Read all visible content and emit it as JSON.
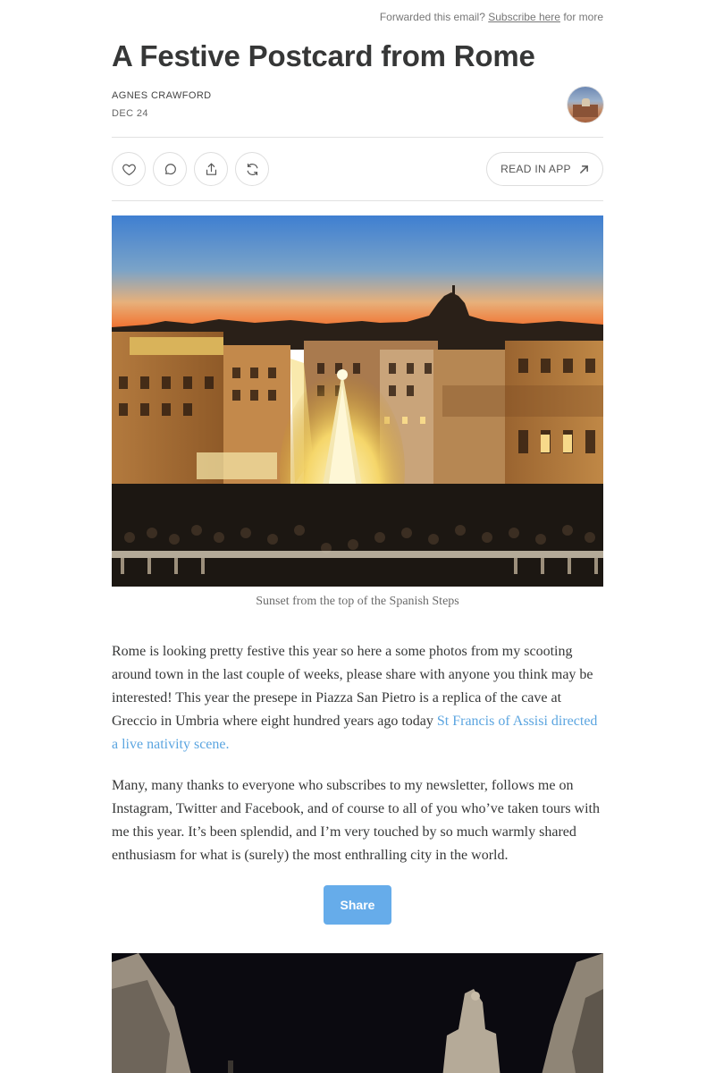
{
  "header": {
    "forward_text": "Forwarded this email?",
    "subscribe_link": "Subscribe here",
    "forward_suffix": "for more"
  },
  "post": {
    "title": "A Festive Postcard from Rome",
    "author": "AGNES CRAWFORD",
    "date": "DEC 24"
  },
  "actions": {
    "like_icon": "heart-icon",
    "comment_icon": "comment-icon",
    "share_icon": "share-icon",
    "restack_icon": "restack-icon",
    "read_in_app_label": "READ IN APP",
    "read_in_app_icon": "arrow-up-right-icon"
  },
  "images": [
    {
      "caption": "Sunset from the top of the Spanish Steps"
    },
    {
      "caption": ""
    }
  ],
  "body": {
    "p1_text": "Rome is looking pretty festive this year so here a some photos from my scooting around town in the last couple of weeks, please share with anyone you think may be interested! This year the presepe in Piazza San Pietro is a replica of the cave at Greccio in Umbria where eight hundred years ago today ",
    "p1_link": "St Francis of Assisi directed a live nativity scene.",
    "p2_text": "Many, many thanks to everyone who subscribes to my newsletter, follows me on Instagram, Twitter and Facebook, and of course to all of you who’ve taken tours with me this year. It’s been splendid, and I’m very touched by so much warmly shared enthusiasm for what is (surely) the most enthralling city in the world."
  },
  "share_button": {
    "label": "Share"
  },
  "colors": {
    "link": "#5ba5e0",
    "share_button": "#66acea",
    "text": "#363737"
  }
}
